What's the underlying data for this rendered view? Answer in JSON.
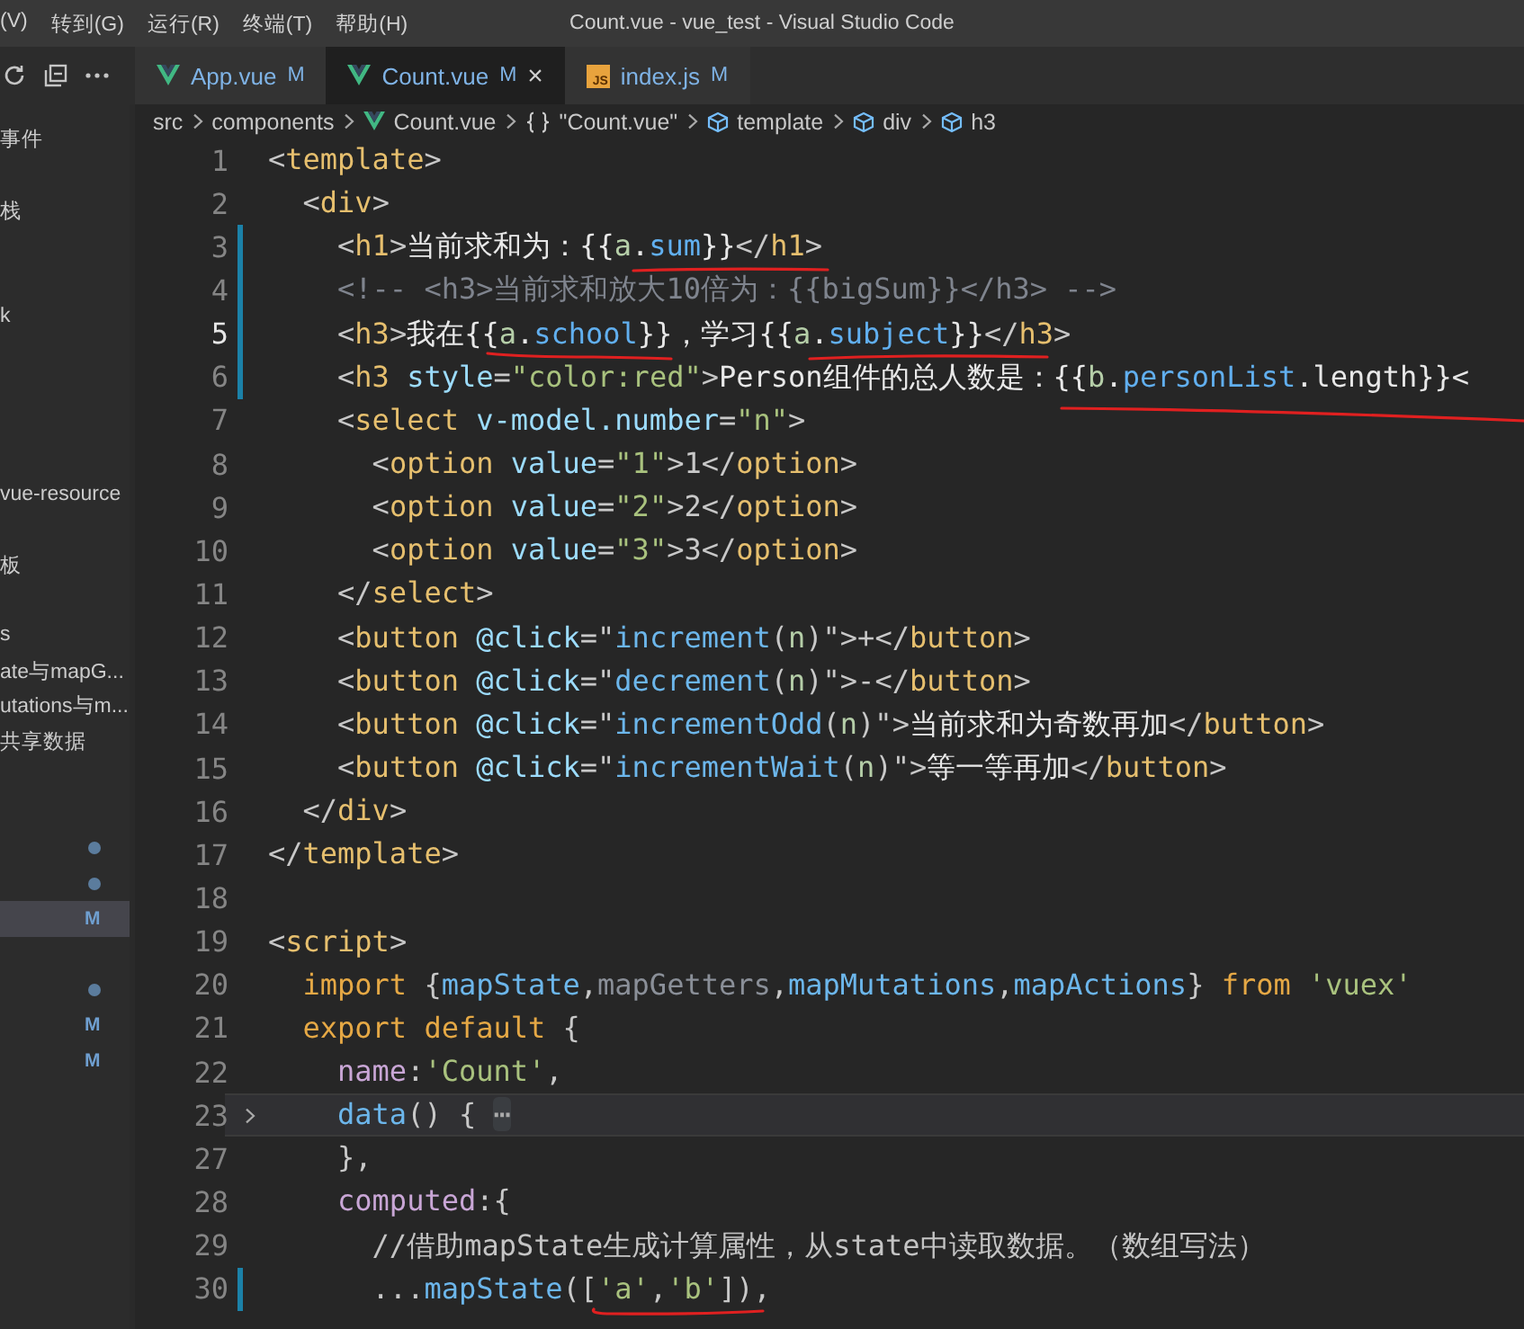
{
  "menu": [
    "(V)",
    "转到(G)",
    "运行(R)",
    "终端(T)",
    "帮助(H)"
  ],
  "window": {
    "title": "Count.vue - vue_test - Visual Studio Code"
  },
  "tabs": [
    {
      "label": "App.vue",
      "status": "M",
      "kind": "vue",
      "selected": false
    },
    {
      "label": "Count.vue",
      "status": "M",
      "kind": "vue",
      "selected": true,
      "close": "×"
    },
    {
      "label": "index.js",
      "status": "M",
      "kind": "js",
      "icon_label": "JS",
      "selected": false
    }
  ],
  "breadcrumb": [
    {
      "label": "src",
      "kind": "folder"
    },
    {
      "label": "components",
      "kind": "folder"
    },
    {
      "label": "Count.vue",
      "kind": "vue"
    },
    {
      "label": "\"Count.vue\"",
      "kind": "module"
    },
    {
      "label": "template",
      "kind": "element"
    },
    {
      "label": "div",
      "kind": "element"
    },
    {
      "label": "h3",
      "kind": "element"
    }
  ],
  "sidebar": {
    "items": [
      {
        "label": "事件",
        "selected": false,
        "dot": false
      },
      {
        "selected": false,
        "dot": false
      },
      {
        "label": "栈",
        "selected": false,
        "dot": false
      },
      {
        "selected": false,
        "dot": false
      },
      {
        "selected": false,
        "dot": false
      },
      {
        "label": "k",
        "selected": false,
        "dot": false
      },
      {
        "selected": false,
        "dot": false
      },
      {
        "selected": false,
        "dot": false
      },
      {
        "selected": false,
        "dot": false
      },
      {
        "selected": false,
        "dot": false
      },
      {
        "label": "vue-resource",
        "selected": false,
        "dot": false
      },
      {
        "selected": false,
        "dot": false
      },
      {
        "label": "板",
        "selected": false,
        "dot": false
      },
      {
        "selected": false,
        "dot": false
      },
      {
        "label": "s",
        "selected": false,
        "dot": false
      },
      {
        "label": "ate与mapG...",
        "selected": false,
        "dot": false
      },
      {
        "label": "utations与m...",
        "selected": false,
        "dot": false
      },
      {
        "label": "共享数据",
        "selected": false,
        "dot": false
      },
      {
        "selected": false,
        "dot": false
      },
      {
        "selected": false,
        "dot": false
      },
      {
        "selected": false,
        "dot": true
      },
      {
        "selected": false,
        "dot": true
      },
      {
        "selected": true,
        "dot": false,
        "badge": "M"
      },
      {
        "selected": false,
        "dot": false
      },
      {
        "selected": false,
        "dot": true
      },
      {
        "selected": false,
        "dot": false,
        "badge": "M"
      },
      {
        "selected": false,
        "dot": false,
        "badge": "M"
      }
    ]
  },
  "editor": {
    "lines": [
      {
        "number": "1",
        "current": false,
        "modified": false,
        "highlighted": false,
        "folded": false,
        "tokens": [
          {
            "text": "<",
            "kind": "punct"
          },
          {
            "text": "template",
            "kind": "tag"
          },
          {
            "text": ">",
            "kind": "punct"
          }
        ]
      },
      {
        "number": "2",
        "current": false,
        "modified": false,
        "highlighted": false,
        "folded": false,
        "tokens": [
          {
            "text": "  <",
            "kind": "punct"
          },
          {
            "text": "div",
            "kind": "tag"
          },
          {
            "text": ">",
            "kind": "punct"
          }
        ]
      },
      {
        "number": "3",
        "current": false,
        "modified": true,
        "highlighted": false,
        "folded": false,
        "tokens": [
          {
            "text": "    <",
            "kind": "punct"
          },
          {
            "text": "h1",
            "kind": "tag"
          },
          {
            "text": ">",
            "kind": "punct"
          },
          {
            "text": "当前求和为：{{",
            "kind": "plain"
          },
          {
            "text": "a",
            "kind": "variable"
          },
          {
            "text": ".",
            "kind": "plain"
          },
          {
            "text": "sum",
            "kind": "property"
          },
          {
            "text": "}}",
            "kind": "plain"
          },
          {
            "text": "</",
            "kind": "punct"
          },
          {
            "text": "h1",
            "kind": "tag"
          },
          {
            "text": ">",
            "kind": "punct"
          }
        ]
      },
      {
        "number": "4",
        "current": false,
        "modified": true,
        "highlighted": false,
        "folded": false,
        "tokens": [
          {
            "text": "    <!-- <h3>当前求和放大10倍为：{{bigSum}}</h3> -->",
            "kind": "comment"
          }
        ]
      },
      {
        "number": "5",
        "current": true,
        "modified": true,
        "highlighted": false,
        "folded": false,
        "tokens": [
          {
            "text": "    <",
            "kind": "punct"
          },
          {
            "text": "h3",
            "kind": "tag"
          },
          {
            "text": ">",
            "kind": "punct"
          },
          {
            "text": "我在{{",
            "kind": "plain"
          },
          {
            "text": "a",
            "kind": "variable"
          },
          {
            "text": ".",
            "kind": "plain"
          },
          {
            "text": "school",
            "kind": "property"
          },
          {
            "text": "}}，学习{{",
            "kind": "plain"
          },
          {
            "text": "a",
            "kind": "variable"
          },
          {
            "text": ".",
            "kind": "plain"
          },
          {
            "text": "subject",
            "kind": "property"
          },
          {
            "text": "}}",
            "kind": "plain"
          },
          {
            "text": "</",
            "kind": "punct"
          },
          {
            "text": "h3",
            "kind": "tag"
          },
          {
            "text": ">",
            "kind": "punct"
          }
        ]
      },
      {
        "number": "6",
        "current": false,
        "modified": true,
        "highlighted": false,
        "folded": false,
        "tokens": [
          {
            "text": "    <",
            "kind": "punct"
          },
          {
            "text": "h3",
            "kind": "tag"
          },
          {
            "text": " style",
            "kind": "attribute"
          },
          {
            "text": "=",
            "kind": "punct"
          },
          {
            "text": "\"color:red\"",
            "kind": "string"
          },
          {
            "text": ">",
            "kind": "punct"
          },
          {
            "text": "Person组件的总人数是：{{",
            "kind": "plain"
          },
          {
            "text": "b",
            "kind": "variable"
          },
          {
            "text": ".",
            "kind": "plain"
          },
          {
            "text": "personList",
            "kind": "property"
          },
          {
            "text": ".length}}<",
            "kind": "plain"
          }
        ]
      },
      {
        "number": "7",
        "current": false,
        "modified": false,
        "highlighted": false,
        "folded": false,
        "tokens": [
          {
            "text": "    <",
            "kind": "punct"
          },
          {
            "text": "select",
            "kind": "tag"
          },
          {
            "text": " v-model.number",
            "kind": "attribute"
          },
          {
            "text": "=",
            "kind": "punct"
          },
          {
            "text": "\"n\"",
            "kind": "string"
          },
          {
            "text": ">",
            "kind": "punct"
          }
        ]
      },
      {
        "number": "8",
        "current": false,
        "modified": false,
        "highlighted": false,
        "folded": false,
        "tokens": [
          {
            "text": "      <",
            "kind": "punct"
          },
          {
            "text": "option",
            "kind": "tag"
          },
          {
            "text": " value",
            "kind": "attribute"
          },
          {
            "text": "=",
            "kind": "punct"
          },
          {
            "text": "\"1\"",
            "kind": "string"
          },
          {
            "text": ">1</",
            "kind": "punct"
          },
          {
            "text": "option",
            "kind": "tag"
          },
          {
            "text": ">",
            "kind": "punct"
          }
        ]
      },
      {
        "number": "9",
        "current": false,
        "modified": false,
        "highlighted": false,
        "folded": false,
        "tokens": [
          {
            "text": "      <",
            "kind": "punct"
          },
          {
            "text": "option",
            "kind": "tag"
          },
          {
            "text": " value",
            "kind": "attribute"
          },
          {
            "text": "=",
            "kind": "punct"
          },
          {
            "text": "\"2\"",
            "kind": "string"
          },
          {
            "text": ">2</",
            "kind": "punct"
          },
          {
            "text": "option",
            "kind": "tag"
          },
          {
            "text": ">",
            "kind": "punct"
          }
        ]
      },
      {
        "number": "10",
        "current": false,
        "modified": false,
        "highlighted": false,
        "folded": false,
        "tokens": [
          {
            "text": "      <",
            "kind": "punct"
          },
          {
            "text": "option",
            "kind": "tag"
          },
          {
            "text": " value",
            "kind": "attribute"
          },
          {
            "text": "=",
            "kind": "punct"
          },
          {
            "text": "\"3\"",
            "kind": "string"
          },
          {
            "text": ">3</",
            "kind": "punct"
          },
          {
            "text": "option",
            "kind": "tag"
          },
          {
            "text": ">",
            "kind": "punct"
          }
        ]
      },
      {
        "number": "11",
        "current": false,
        "modified": false,
        "highlighted": false,
        "folded": false,
        "tokens": [
          {
            "text": "    </",
            "kind": "punct"
          },
          {
            "text": "select",
            "kind": "tag"
          },
          {
            "text": ">",
            "kind": "punct"
          }
        ]
      },
      {
        "number": "12",
        "current": false,
        "modified": false,
        "highlighted": false,
        "folded": false,
        "tokens": [
          {
            "text": "    <",
            "kind": "punct"
          },
          {
            "text": "button",
            "kind": "tag"
          },
          {
            "text": " @click",
            "kind": "attribute"
          },
          {
            "text": "=\"",
            "kind": "punct"
          },
          {
            "text": "increment",
            "kind": "function"
          },
          {
            "text": "(",
            "kind": "punct"
          },
          {
            "text": "n",
            "kind": "variable"
          },
          {
            "text": ")\">+</",
            "kind": "punct"
          },
          {
            "text": "button",
            "kind": "tag"
          },
          {
            "text": ">",
            "kind": "punct"
          }
        ]
      },
      {
        "number": "13",
        "current": false,
        "modified": false,
        "highlighted": false,
        "folded": false,
        "tokens": [
          {
            "text": "    <",
            "kind": "punct"
          },
          {
            "text": "button",
            "kind": "tag"
          },
          {
            "text": " @click",
            "kind": "attribute"
          },
          {
            "text": "=\"",
            "kind": "punct"
          },
          {
            "text": "decrement",
            "kind": "function"
          },
          {
            "text": "(",
            "kind": "punct"
          },
          {
            "text": "n",
            "kind": "variable"
          },
          {
            "text": ")\">-</",
            "kind": "punct"
          },
          {
            "text": "button",
            "kind": "tag"
          },
          {
            "text": ">",
            "kind": "punct"
          }
        ]
      },
      {
        "number": "14",
        "current": false,
        "modified": false,
        "highlighted": false,
        "folded": false,
        "tokens": [
          {
            "text": "    <",
            "kind": "punct"
          },
          {
            "text": "button",
            "kind": "tag"
          },
          {
            "text": " @click",
            "kind": "attribute"
          },
          {
            "text": "=\"",
            "kind": "punct"
          },
          {
            "text": "incrementOdd",
            "kind": "function"
          },
          {
            "text": "(",
            "kind": "punct"
          },
          {
            "text": "n",
            "kind": "variable"
          },
          {
            "text": ")\">",
            "kind": "punct"
          },
          {
            "text": "当前求和为奇数再加",
            "kind": "plain"
          },
          {
            "text": "</",
            "kind": "punct"
          },
          {
            "text": "button",
            "kind": "tag"
          },
          {
            "text": ">",
            "kind": "punct"
          }
        ]
      },
      {
        "number": "15",
        "current": false,
        "modified": false,
        "highlighted": false,
        "folded": false,
        "tokens": [
          {
            "text": "    <",
            "kind": "punct"
          },
          {
            "text": "button",
            "kind": "tag"
          },
          {
            "text": " @click",
            "kind": "attribute"
          },
          {
            "text": "=\"",
            "kind": "punct"
          },
          {
            "text": "incrementWait",
            "kind": "function"
          },
          {
            "text": "(",
            "kind": "punct"
          },
          {
            "text": "n",
            "kind": "variable"
          },
          {
            "text": ")\">",
            "kind": "punct"
          },
          {
            "text": "等一等再加",
            "kind": "plain"
          },
          {
            "text": "</",
            "kind": "punct"
          },
          {
            "text": "button",
            "kind": "tag"
          },
          {
            "text": ">",
            "kind": "punct"
          }
        ]
      },
      {
        "number": "16",
        "current": false,
        "modified": false,
        "highlighted": false,
        "folded": false,
        "tokens": [
          {
            "text": "  </",
            "kind": "punct"
          },
          {
            "text": "div",
            "kind": "tag"
          },
          {
            "text": ">",
            "kind": "punct"
          }
        ]
      },
      {
        "number": "17",
        "current": false,
        "modified": false,
        "highlighted": false,
        "folded": false,
        "tokens": [
          {
            "text": "</",
            "kind": "punct"
          },
          {
            "text": "template",
            "kind": "tag"
          },
          {
            "text": ">",
            "kind": "punct"
          }
        ]
      },
      {
        "number": "18",
        "current": false,
        "modified": false,
        "highlighted": false,
        "folded": false
      },
      {
        "number": "19",
        "current": false,
        "modified": false,
        "highlighted": false,
        "folded": false,
        "tokens": [
          {
            "text": "<",
            "kind": "punct"
          },
          {
            "text": "script",
            "kind": "tag"
          },
          {
            "text": ">",
            "kind": "punct"
          }
        ]
      },
      {
        "number": "20",
        "current": false,
        "modified": false,
        "highlighted": false,
        "folded": false,
        "tokens": [
          {
            "text": "  import",
            "kind": "keyword"
          },
          {
            "text": " {",
            "kind": "punct"
          },
          {
            "text": "mapState",
            "kind": "function"
          },
          {
            "text": ",",
            "kind": "punct"
          },
          {
            "text": "mapGetters",
            "kind": "unused"
          },
          {
            "text": ",",
            "kind": "punct"
          },
          {
            "text": "mapMutations",
            "kind": "function"
          },
          {
            "text": ",",
            "kind": "punct"
          },
          {
            "text": "mapActions",
            "kind": "function"
          },
          {
            "text": "} ",
            "kind": "punct"
          },
          {
            "text": "from",
            "kind": "keyword"
          },
          {
            "text": " 'vuex'",
            "kind": "string"
          }
        ]
      },
      {
        "number": "21",
        "current": false,
        "modified": false,
        "highlighted": false,
        "folded": false,
        "tokens": [
          {
            "text": "  export default",
            "kind": "keyword"
          },
          {
            "text": " {",
            "kind": "punct"
          }
        ]
      },
      {
        "number": "22",
        "current": false,
        "modified": false,
        "highlighted": false,
        "folded": false,
        "tokens": [
          {
            "text": "    name",
            "kind": "key"
          },
          {
            "text": ":",
            "kind": "punct"
          },
          {
            "text": "'Count'",
            "kind": "string"
          },
          {
            "text": ",",
            "kind": "punct"
          }
        ]
      },
      {
        "number": "23",
        "current": false,
        "modified": false,
        "highlighted": true,
        "folded": true,
        "tokens": [
          {
            "text": "    data",
            "kind": "function"
          },
          {
            "text": "() { ",
            "kind": "punct"
          },
          {
            "text": "⋯",
            "kind": "fold"
          }
        ]
      },
      {
        "number": "27",
        "current": false,
        "modified": false,
        "highlighted": false,
        "folded": false,
        "tokens": [
          {
            "text": "    },",
            "kind": "punct"
          }
        ]
      },
      {
        "number": "28",
        "current": false,
        "modified": false,
        "highlighted": false,
        "folded": false,
        "tokens": [
          {
            "text": "    computed",
            "kind": "key"
          },
          {
            "text": ":{",
            "kind": "punct"
          }
        ]
      },
      {
        "number": "29",
        "current": false,
        "modified": false,
        "highlighted": false,
        "folded": false,
        "tokens": [
          {
            "text": "      //借助mapState生成计算属性，从state中读取数据。（数组写法）",
            "kind": "note"
          }
        ]
      },
      {
        "number": "30",
        "current": false,
        "modified": true,
        "highlighted": false,
        "folded": false,
        "tokens": [
          {
            "text": "      ...",
            "kind": "punct"
          },
          {
            "text": "mapState",
            "kind": "function"
          },
          {
            "text": "([",
            "kind": "punct"
          },
          {
            "text": "'a'",
            "kind": "string"
          },
          {
            "text": ",",
            "kind": "punct"
          },
          {
            "text": "'b'",
            "kind": "string"
          },
          {
            "text": "]),",
            "kind": "punct"
          }
        ]
      }
    ]
  }
}
